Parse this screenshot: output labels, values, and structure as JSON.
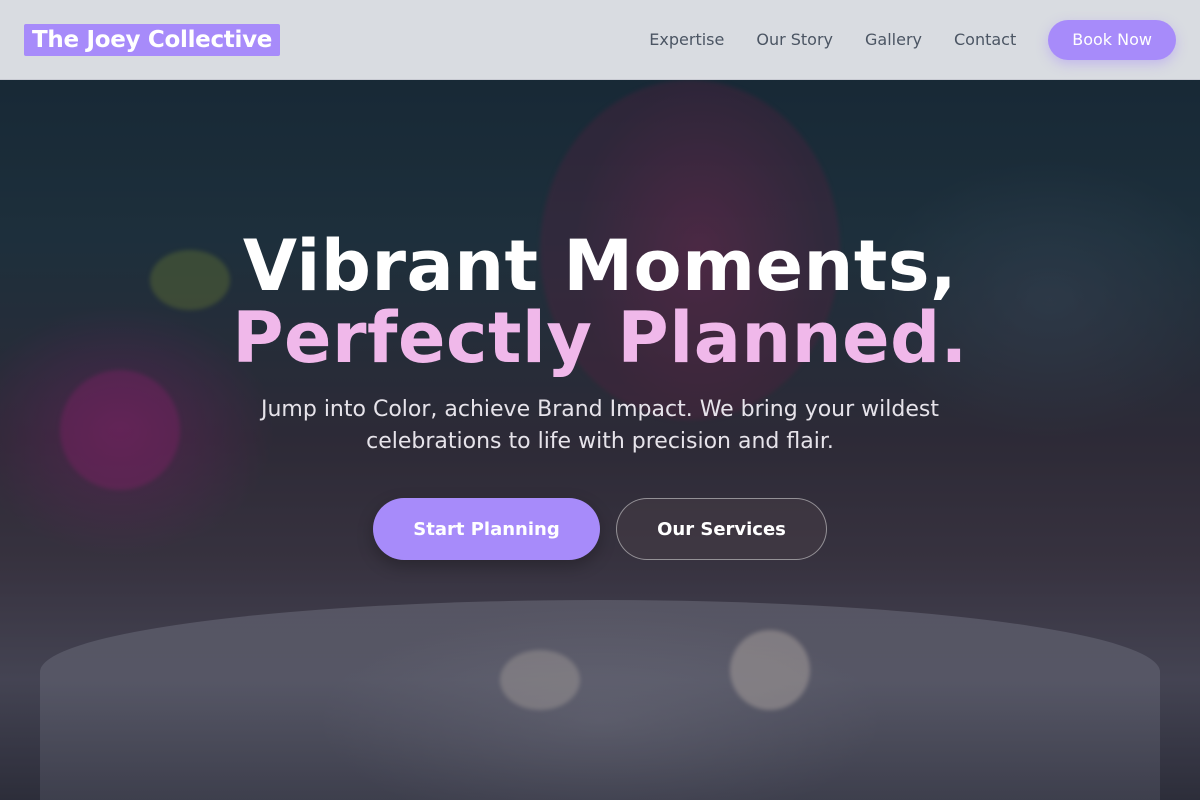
{
  "header": {
    "logo": "The Joey Collective",
    "nav": [
      {
        "label": "Expertise"
      },
      {
        "label": "Our Story"
      },
      {
        "label": "Gallery"
      },
      {
        "label": "Contact"
      }
    ],
    "cta_label": "Book Now"
  },
  "hero": {
    "title_line1": "Vibrant Moments,",
    "title_line2": "Perfectly Planned.",
    "subtitle": "Jump into Color, achieve Brand Impact. We bring your wildest celebrations to life with precision and flair.",
    "primary_button": "Start Planning",
    "secondary_button": "Our Services"
  },
  "colors": {
    "accent": "#a78bfa",
    "title_highlight": "#f0b8ea",
    "header_bg": "#e2e4e8"
  }
}
